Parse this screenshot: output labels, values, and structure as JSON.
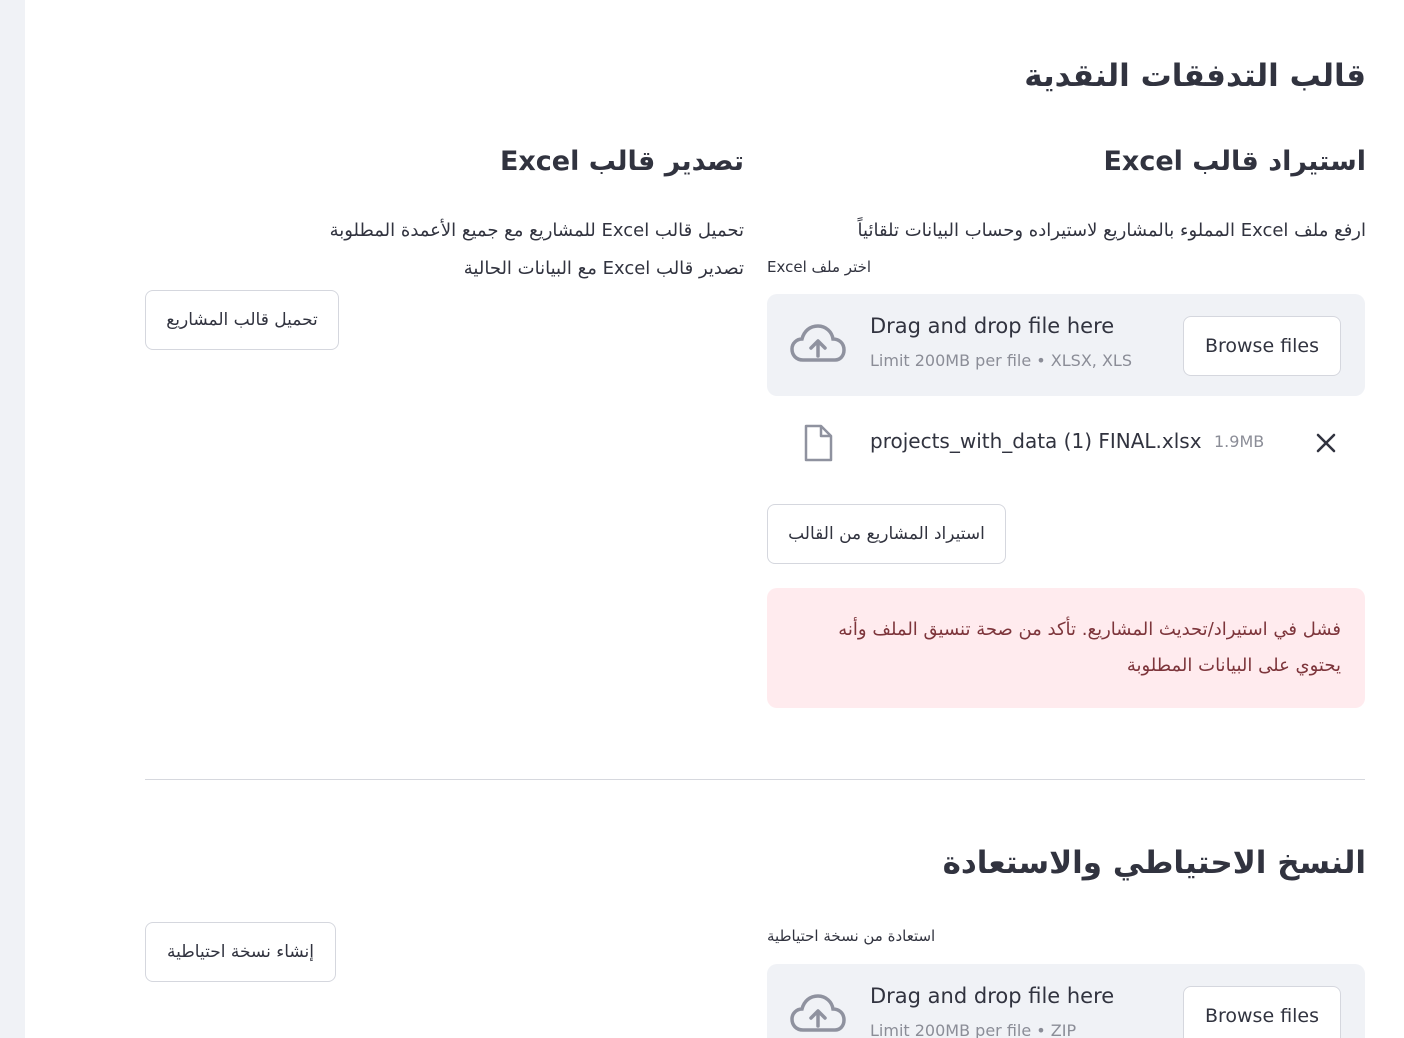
{
  "page": {
    "title": "قالب التدفقات النقدية"
  },
  "import_section": {
    "heading": "استيراد قالب Excel",
    "description": "ارفع ملف Excel المملوء بالمشاريع لاستيراده وحساب البيانات تلقائياً",
    "uploader_label": "اختر ملف Excel",
    "dropzone": {
      "title": "Drag and drop file here",
      "subtitle": "Limit 200MB per file • XLSX, XLS",
      "browse_label": "Browse files",
      "icon": "cloud-upload-icon"
    },
    "uploaded_file": {
      "name": "projects_with_data (1) FINAL.xlsx",
      "size": "1.9MB",
      "icon": "file-icon",
      "remove_icon": "close-icon"
    },
    "import_button_label": "استيراد المشاريع من القالب",
    "error_message": "فشل في استيراد/تحديث المشاريع. تأكد من صحة تنسيق الملف وأنه يحتوي على البيانات المطلوبة",
    "error_color": "#ffebee"
  },
  "export_section": {
    "heading": "تصدير قالب Excel",
    "line1": "تحميل قالب Excel للمشاريع مع جميع الأعمدة المطلوبة",
    "line2": "تصدير قالب Excel مع البيانات الحالية",
    "download_button_label": "تحميل قالب المشاريع"
  },
  "backup_section": {
    "heading": "النسخ الاحتياطي والاستعادة",
    "restore_label": "استعادة من نسخة احتياطية",
    "dropzone": {
      "title": "Drag and drop file here",
      "subtitle": "Limit 200MB per file • ZIP",
      "browse_label": "Browse files",
      "icon": "cloud-upload-icon"
    },
    "create_backup_label": "إنشاء نسخة احتياطية"
  }
}
